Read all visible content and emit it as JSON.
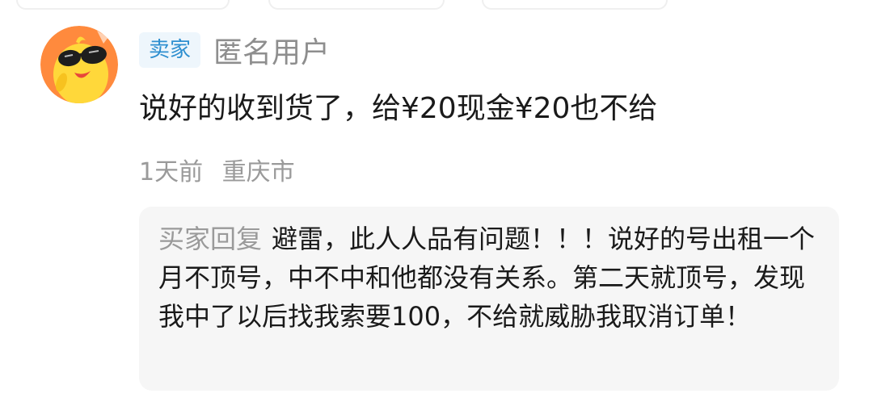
{
  "comment": {
    "role_badge": "卖家",
    "username": "匿名用户",
    "text": "说好的收到货了，给¥20现金¥20也不给",
    "time": "1天前",
    "location": "重庆市"
  },
  "reply": {
    "label": "买家回复",
    "text": "避雷，此人人品有问题！！！说好的号出租一个月不顶号，中不中和他都没有关系。第二天就顶号，发现我中了以后找我索要100，不给就威胁我取消订单！"
  },
  "colors": {
    "badge_bg": "#eef6fc",
    "badge_text": "#2e8fd0",
    "muted_text": "#9a9a9a",
    "reply_bg": "#f6f6f6",
    "avatar_bg": "#ff8a3d",
    "avatar_chick": "#ffd83a"
  },
  "icons": {
    "avatar": "yellow-chick-with-sunglasses-avatar"
  }
}
